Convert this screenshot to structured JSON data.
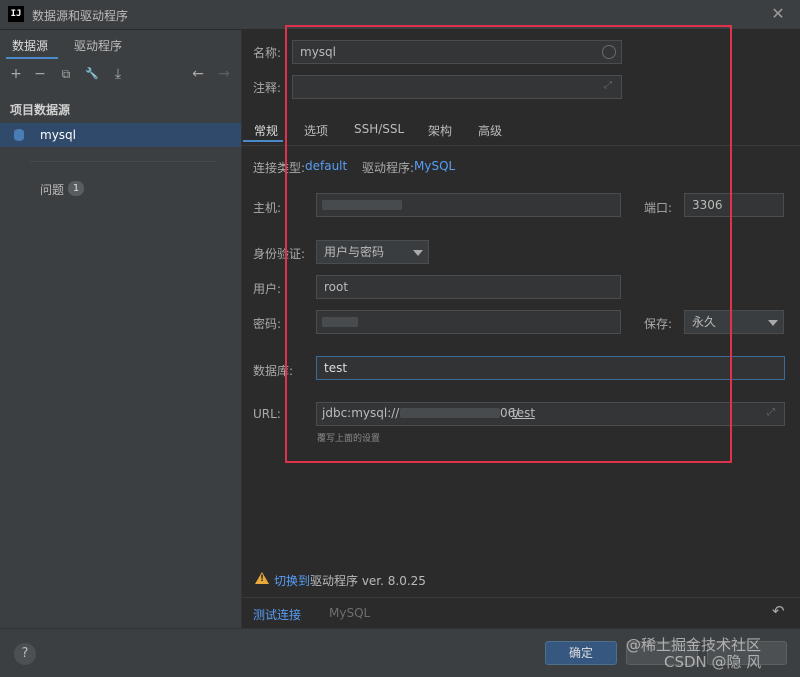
{
  "window": {
    "icon_text": "IJ",
    "title": "数据源和驱动程序",
    "close_glyph": "✕"
  },
  "left_panel": {
    "tabs": [
      {
        "label": "数据源",
        "active": true
      },
      {
        "label": "驱动程序",
        "active": false
      }
    ],
    "toolbar": {
      "add": "+",
      "remove": "−",
      "copy": "⧉",
      "settings": "🔧",
      "import": "⤓",
      "back": "←",
      "forward": "→"
    },
    "section_title": "项目数据源",
    "datasources": [
      {
        "name": "mysql",
        "selected": true
      }
    ],
    "problems_label": "问题",
    "problems_count": "1"
  },
  "form": {
    "name_label": "名称:",
    "name_value": "mysql",
    "comment_label": "注释:",
    "comment_value": "",
    "tabs": [
      "常规",
      "选项",
      "SSH/SSL",
      "架构",
      "高级"
    ],
    "active_tab": "常规",
    "connection_type_label": "连接类型:",
    "connection_type_value": "default",
    "driver_label": "驱动程序:",
    "driver_value": "MySQL",
    "host_label": "主机:",
    "host_value": "",
    "port_label": "端口:",
    "port_value": "3306",
    "auth_label": "身份验证:",
    "auth_value": "用户与密码",
    "user_label": "用户:",
    "user_value": "root",
    "password_label": "密码:",
    "password_value": "",
    "save_label": "保存:",
    "save_value": "永久",
    "database_label": "数据库:",
    "database_value": "test",
    "url_label": "URL:",
    "url_prefix": "jdbc:mysql://",
    "url_port_tail": "06/",
    "url_db": "test",
    "url_hint": "覆写上面的设置"
  },
  "footer": {
    "warning_link": "切换到",
    "warning_text": "驱动程序 ver. 8.0.25",
    "test_connection": "测试连接",
    "driver_name": "MySQL",
    "reset_glyph": "↶",
    "help": "?",
    "ok": "确定",
    "watermark_1": "@稀土掘金技术社区",
    "watermark_2": "CSDN @隐 风"
  },
  "colors": {
    "accent": "#4a88c7",
    "link": "#589df6",
    "highlight_box": "#e0324b",
    "selection": "#2f4a6b"
  }
}
